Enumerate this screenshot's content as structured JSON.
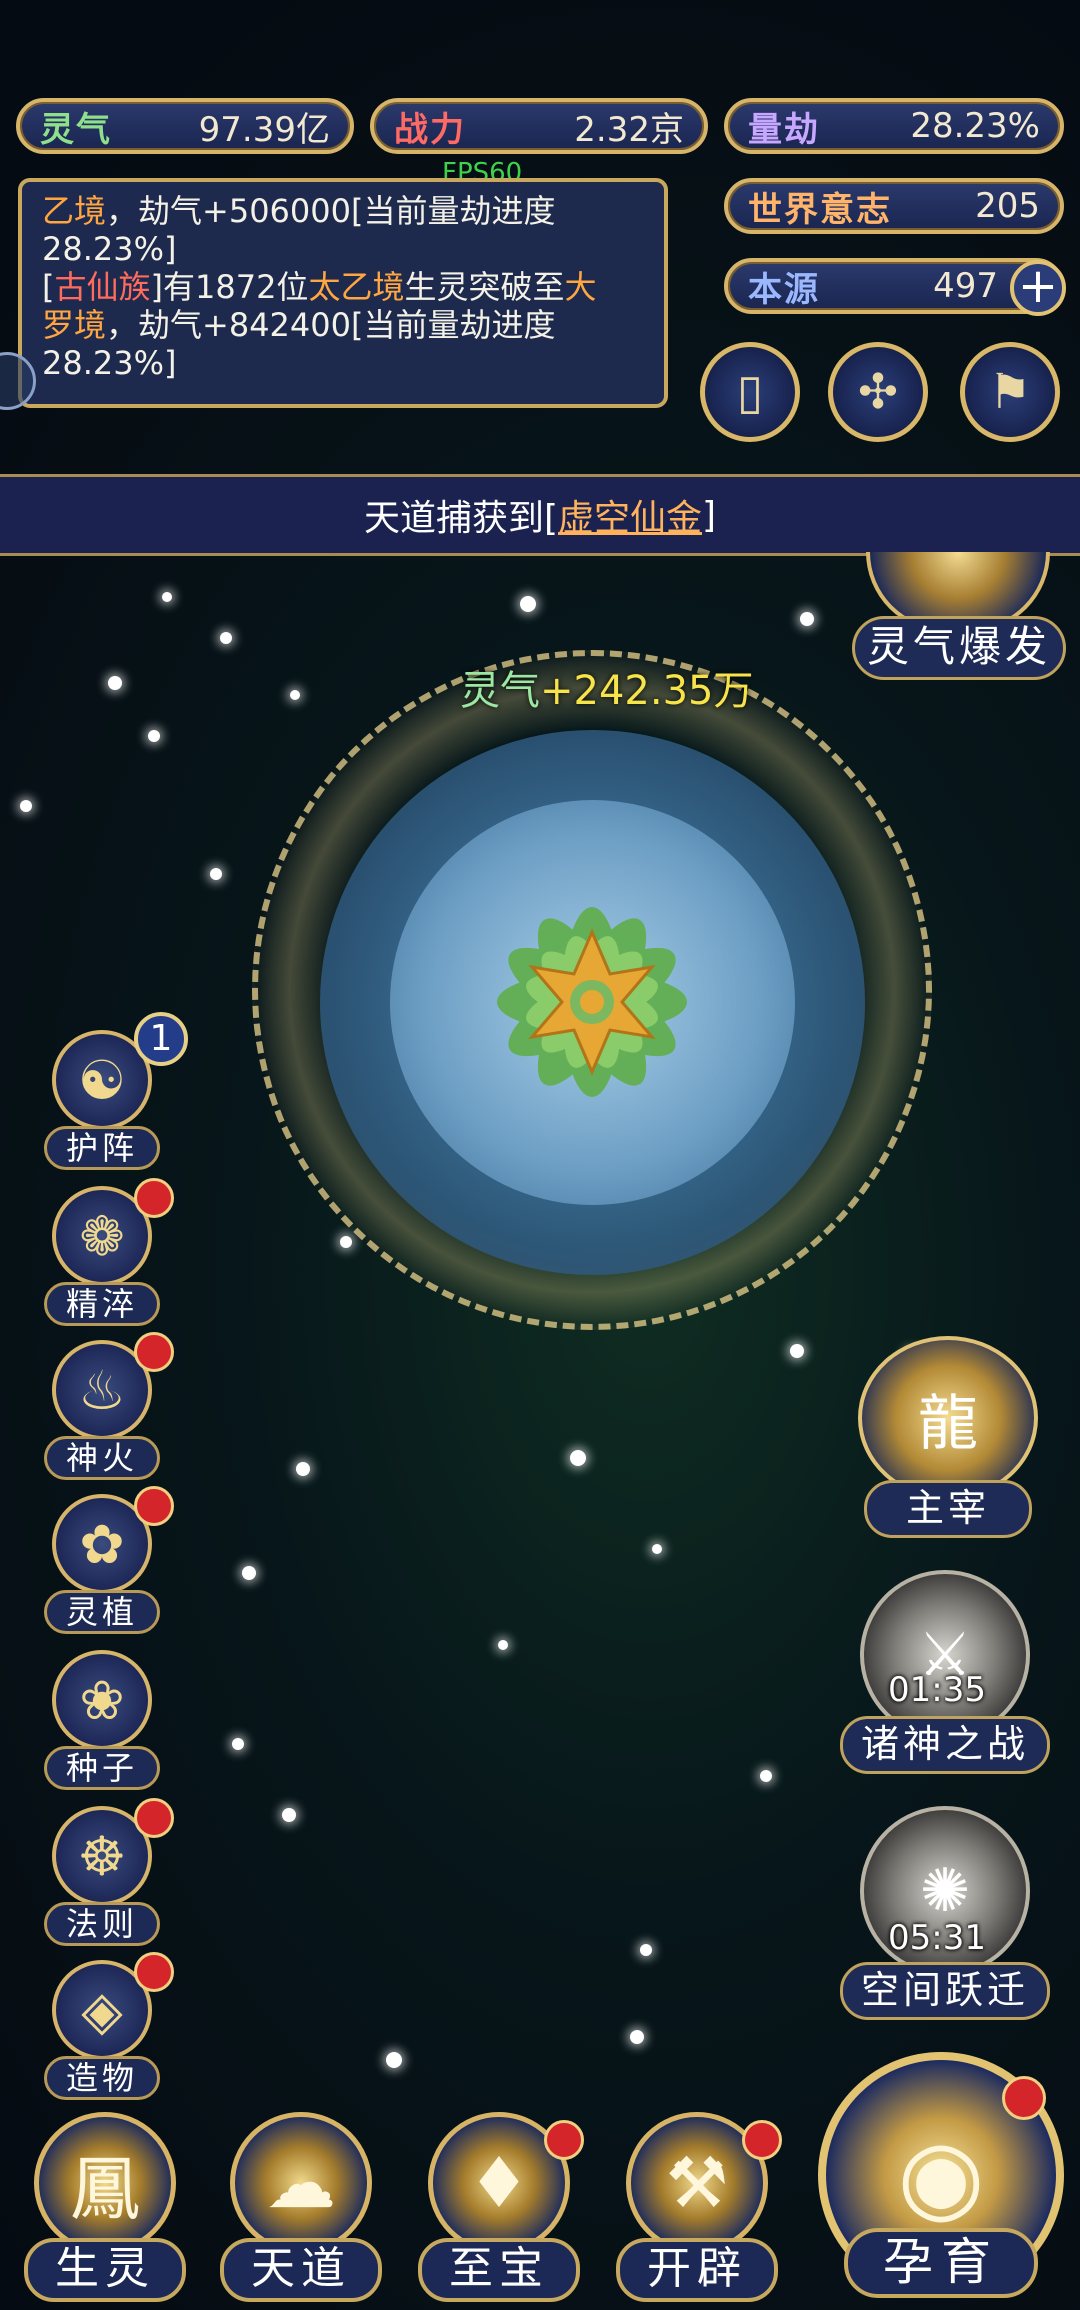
{
  "fps": "FPS60",
  "stats": {
    "lingqi": {
      "label": "灵气",
      "value": "97.39亿"
    },
    "zhanli": {
      "label": "战力",
      "value": "2.32京"
    },
    "liangjie": {
      "label": "量劫",
      "value": "28.23%"
    },
    "world_will": {
      "label": "世界意志",
      "value": "205"
    },
    "source": {
      "label": "本源",
      "value": "497",
      "add_icon": "plus-icon"
    }
  },
  "log": {
    "line1_a": "乙境",
    "line1_b": "，劫气+506000[当前量劫进度",
    "line1_c": "28.23%]",
    "line2_a": "[",
    "line2_clan": "古仙族",
    "line2_b": "]有1872位",
    "line2_realm": "太乙境",
    "line2_c": "生灵突破至",
    "line2_realm2a": "大",
    "line2_realm2b": "罗境",
    "line2_d": "，劫气+842400[当前量劫进度",
    "line2_e": "28.23%]"
  },
  "top_buttons": [
    {
      "icon": "cards-icon",
      "glyph": "▯"
    },
    {
      "icon": "vortex-icon",
      "glyph": "✣"
    },
    {
      "icon": "flag-icon",
      "glyph": "⚑"
    }
  ],
  "banner": {
    "prefix": "天道捕获到[",
    "item": "虚空仙金",
    "suffix": "]"
  },
  "burst_button": "灵气爆发",
  "gain": {
    "key": "灵气",
    "value": "+242.35万"
  },
  "left_menu": [
    {
      "label": "护阵",
      "icon": "yinyang-icon",
      "glyph": "☯",
      "badge": "1"
    },
    {
      "label": "精淬",
      "icon": "lotus-flame-icon",
      "glyph": "❁"
    },
    {
      "label": "神火",
      "icon": "fire-icon",
      "glyph": "♨"
    },
    {
      "label": "灵植",
      "icon": "plant-icon",
      "glyph": "✿"
    },
    {
      "label": "种子",
      "icon": "seed-icon",
      "glyph": "❀"
    },
    {
      "label": "法则",
      "icon": "rune-icon",
      "glyph": "☸"
    },
    {
      "label": "造物",
      "icon": "creation-icon",
      "glyph": "◈"
    }
  ],
  "right_features": {
    "master": {
      "label": "主宰",
      "icon": "dragon-icon",
      "glyph": "龍"
    },
    "war": {
      "label": "诸神之战",
      "timer": "01:35",
      "icon": "sword-icon",
      "glyph": "⚔"
    },
    "leap": {
      "label": "空间跃迁",
      "timer": "05:31",
      "icon": "vortex-icon",
      "glyph": "✺"
    }
  },
  "bottom_nav": [
    {
      "label": "生灵",
      "icon": "phoenix-icon",
      "glyph": "鳳"
    },
    {
      "label": "天道",
      "icon": "cloud-swirl-icon",
      "glyph": "☁"
    },
    {
      "label": "至宝",
      "icon": "treasure-icon",
      "glyph": "♦"
    },
    {
      "label": "开辟",
      "icon": "axe-icon",
      "glyph": "⚒"
    }
  ],
  "incubate": {
    "label": "孕育",
    "icon": "embryo-icon",
    "glyph": "◉"
  }
}
